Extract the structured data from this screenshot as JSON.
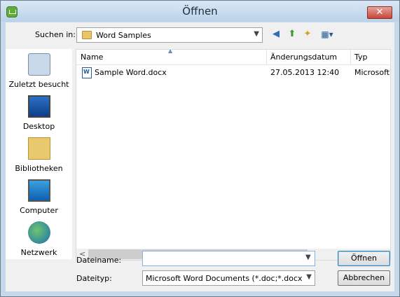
{
  "window": {
    "title": "Öffnen",
    "close_label": "✕"
  },
  "toolbar": {
    "look_in_label": "Suchen in:",
    "look_in_value": "Word Samples"
  },
  "places": [
    {
      "label": "Zuletzt besucht",
      "icon": "recent-places-icon"
    },
    {
      "label": "Desktop",
      "icon": "desktop-icon"
    },
    {
      "label": "Bibliotheken",
      "icon": "libraries-icon"
    },
    {
      "label": "Computer",
      "icon": "computer-icon"
    },
    {
      "label": "Netzwerk",
      "icon": "network-icon"
    }
  ],
  "file_list": {
    "columns": [
      "Name",
      "Änderungsdatum",
      "Typ"
    ],
    "rows": [
      {
        "name": "Sample Word.docx",
        "date": "27.05.2013 12:40",
        "type": "Microsoft"
      }
    ]
  },
  "form": {
    "filename_label": "Dateiname:",
    "filename_value": "",
    "filetype_label": "Dateityp:",
    "filetype_value": "Microsoft Word Documents (*.doc;*.docx;*.dot;*"
  },
  "buttons": {
    "open": "Öffnen",
    "cancel": "Abbrechen"
  }
}
